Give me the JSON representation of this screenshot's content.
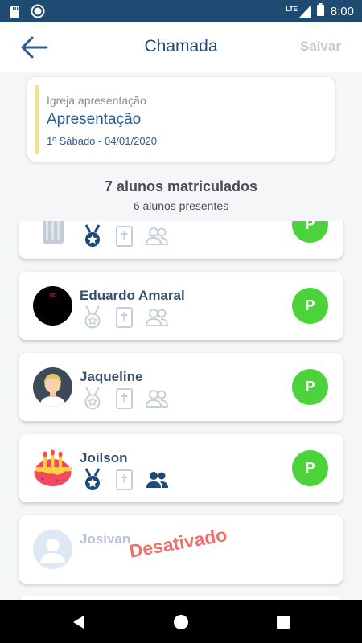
{
  "status_bar": {
    "time": "8:00",
    "network": "LTE"
  },
  "app_bar": {
    "title": "Chamada",
    "save_label": "Salvar"
  },
  "class_info": {
    "church": "Igreja apresentação",
    "name": "Apresentação",
    "date": "1º Sábado - 04/01/2020"
  },
  "summary": {
    "enrolled": "7 alunos matriculados",
    "present": "6 alunos presentes"
  },
  "students": [
    {
      "name": "",
      "status": "P",
      "badges": [
        "medal-active",
        "bible-inactive",
        "group-inactive"
      ]
    },
    {
      "name": "Eduardo Amaral",
      "status": "P",
      "badges": [
        "medal-inactive",
        "bible-inactive",
        "group-inactive"
      ]
    },
    {
      "name": "Jaqueline",
      "status": "P",
      "badges": [
        "medal-inactive",
        "bible-inactive",
        "group-inactive"
      ]
    },
    {
      "name": "Joilson",
      "status": "P",
      "badges": [
        "medal-active",
        "bible-inactive",
        "group-active"
      ]
    },
    {
      "name": "Josivan",
      "status_text": "Desativado"
    }
  ],
  "colors": {
    "primary": "#1f4b72",
    "title": "#1d4a78",
    "accent_yellow": "#f2e28a",
    "present_green": "#4cd23b",
    "disabled_red": "#ef6f6c",
    "badge_active": "#1d4a78",
    "badge_inactive": "#c5cfdc"
  }
}
